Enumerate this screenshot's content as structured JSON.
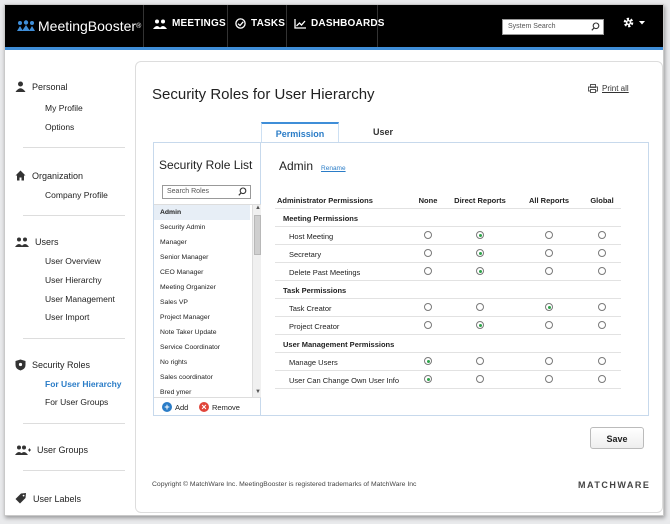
{
  "app": {
    "logo": "MeetingBooster",
    "logo_reg": "®"
  },
  "nav": [
    {
      "label": "MEETINGS",
      "icon": "meetings-icon"
    },
    {
      "label": "TASKS",
      "icon": "tasks-icon"
    },
    {
      "label": "DASHBOARDS",
      "icon": "dashboards-icon"
    }
  ],
  "search": {
    "placeholder": "System Search"
  },
  "sidebar": {
    "personal": {
      "label": "Personal",
      "items": [
        "My Profile",
        "Options"
      ]
    },
    "organization": {
      "label": "Organization",
      "items": [
        "Company Profile"
      ]
    },
    "users": {
      "label": "Users",
      "items": [
        "User Overview",
        "User Hierarchy",
        "User Management",
        "User Import"
      ]
    },
    "security": {
      "label": "Security Roles",
      "items": [
        "For User Hierarchy",
        "For User Groups"
      ]
    },
    "groups": {
      "label": "User Groups"
    },
    "labels": {
      "label": "User Labels"
    }
  },
  "page": {
    "title": "Security Roles for User Hierarchy",
    "print_all": "Print all"
  },
  "tabs": {
    "permission": "Permission",
    "user": "User"
  },
  "role_list": {
    "title": "Security Role List",
    "search_placeholder": "Search Roles",
    "items": [
      "Admin",
      "Security Admin",
      "Manager",
      "Senior Manager",
      "CEO Manager",
      "Meeting Organizer",
      "Sales VP",
      "Project Manager",
      "Note Taker Update",
      "Service Coordinator",
      "No rights",
      "Sales coordinator",
      "Bred ymer"
    ],
    "selected": "Admin",
    "add": "Add",
    "remove": "Remove"
  },
  "role": {
    "name": "Admin",
    "rename": "Rename"
  },
  "permissions": {
    "header": {
      "label": "Administrator Permissions",
      "cols": [
        "None",
        "Direct Reports",
        "All Reports",
        "Global"
      ]
    },
    "groups": [
      {
        "label": "Meeting Permissions",
        "rows": [
          {
            "label": "Host Meeting",
            "selected": 1
          },
          {
            "label": "Secretary",
            "selected": 1
          },
          {
            "label": "Delete Past Meetings",
            "selected": 1
          }
        ]
      },
      {
        "label": "Task Permissions",
        "rows": [
          {
            "label": "Task Creator",
            "selected": 2
          },
          {
            "label": "Project Creator",
            "selected": 1
          }
        ]
      },
      {
        "label": "User Management Permissions",
        "rows": [
          {
            "label": "Manage Users",
            "selected": 0
          },
          {
            "label": "User Can Change Own User Info",
            "selected": 0
          }
        ]
      }
    ]
  },
  "save": "Save",
  "footer": {
    "copyright": "Copyright © MatchWare Inc.  MeetingBooster is registered trademarks of MatchWare Inc",
    "brand": "MATCHWARE"
  },
  "colors": {
    "accent": "#3f8ed8",
    "topbar": "#000000",
    "radio_on": "#2fa34a",
    "add": "#2a7cc7",
    "remove": "#e0443a"
  }
}
